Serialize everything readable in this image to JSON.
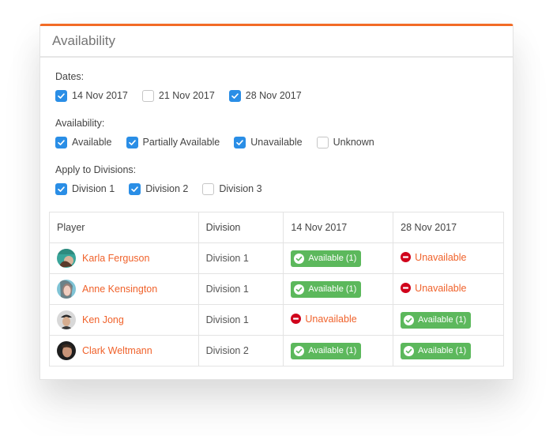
{
  "card": {
    "title": "Availability",
    "accent_color": "#f26b26"
  },
  "filters": {
    "dates": {
      "label": "Dates:",
      "options": [
        {
          "label": "14 Nov 2017",
          "checked": true
        },
        {
          "label": "21 Nov 2017",
          "checked": false
        },
        {
          "label": "28 Nov 2017",
          "checked": true
        }
      ]
    },
    "availability": {
      "label": "Availability:",
      "options": [
        {
          "label": "Available",
          "checked": true
        },
        {
          "label": "Partially Available",
          "checked": true
        },
        {
          "label": "Unavailable",
          "checked": true
        },
        {
          "label": "Unknown",
          "checked": false
        }
      ]
    },
    "divisions": {
      "label": "Apply to Divisions:",
      "options": [
        {
          "label": "Division 1",
          "checked": true
        },
        {
          "label": "Division 2",
          "checked": true
        },
        {
          "label": "Division 3",
          "checked": false
        }
      ]
    }
  },
  "table": {
    "headers": [
      "Player",
      "Division",
      "14 Nov 2017",
      "28 Nov 2017"
    ],
    "rows": [
      {
        "player": "Karla Ferguson",
        "avatar": "avatar-karla",
        "division": "Division 1",
        "d1": {
          "status": "available",
          "label": "Available (1)"
        },
        "d2": {
          "status": "unavailable",
          "label": "Unavailable"
        }
      },
      {
        "player": "Anne Kensington",
        "avatar": "avatar-anne",
        "division": "Division 1",
        "d1": {
          "status": "available",
          "label": "Available (1)"
        },
        "d2": {
          "status": "unavailable",
          "label": "Unavailable"
        }
      },
      {
        "player": "Ken Jong",
        "avatar": "avatar-ken",
        "division": "Division 1",
        "d1": {
          "status": "unavailable",
          "label": "Unavailable"
        },
        "d2": {
          "status": "available",
          "label": "Available (1)"
        }
      },
      {
        "player": "Clark Weltmann",
        "avatar": "avatar-clark",
        "division": "Division 2",
        "d1": {
          "status": "available",
          "label": "Available (1)"
        },
        "d2": {
          "status": "available",
          "label": "Available (1)"
        }
      }
    ]
  },
  "colors": {
    "checkbox_on": "#2a8ee6",
    "available": "#5cb85c",
    "unavailable_text": "#f0622b",
    "unavailable_icon": "#d0021b",
    "player_link": "#f0622b"
  }
}
